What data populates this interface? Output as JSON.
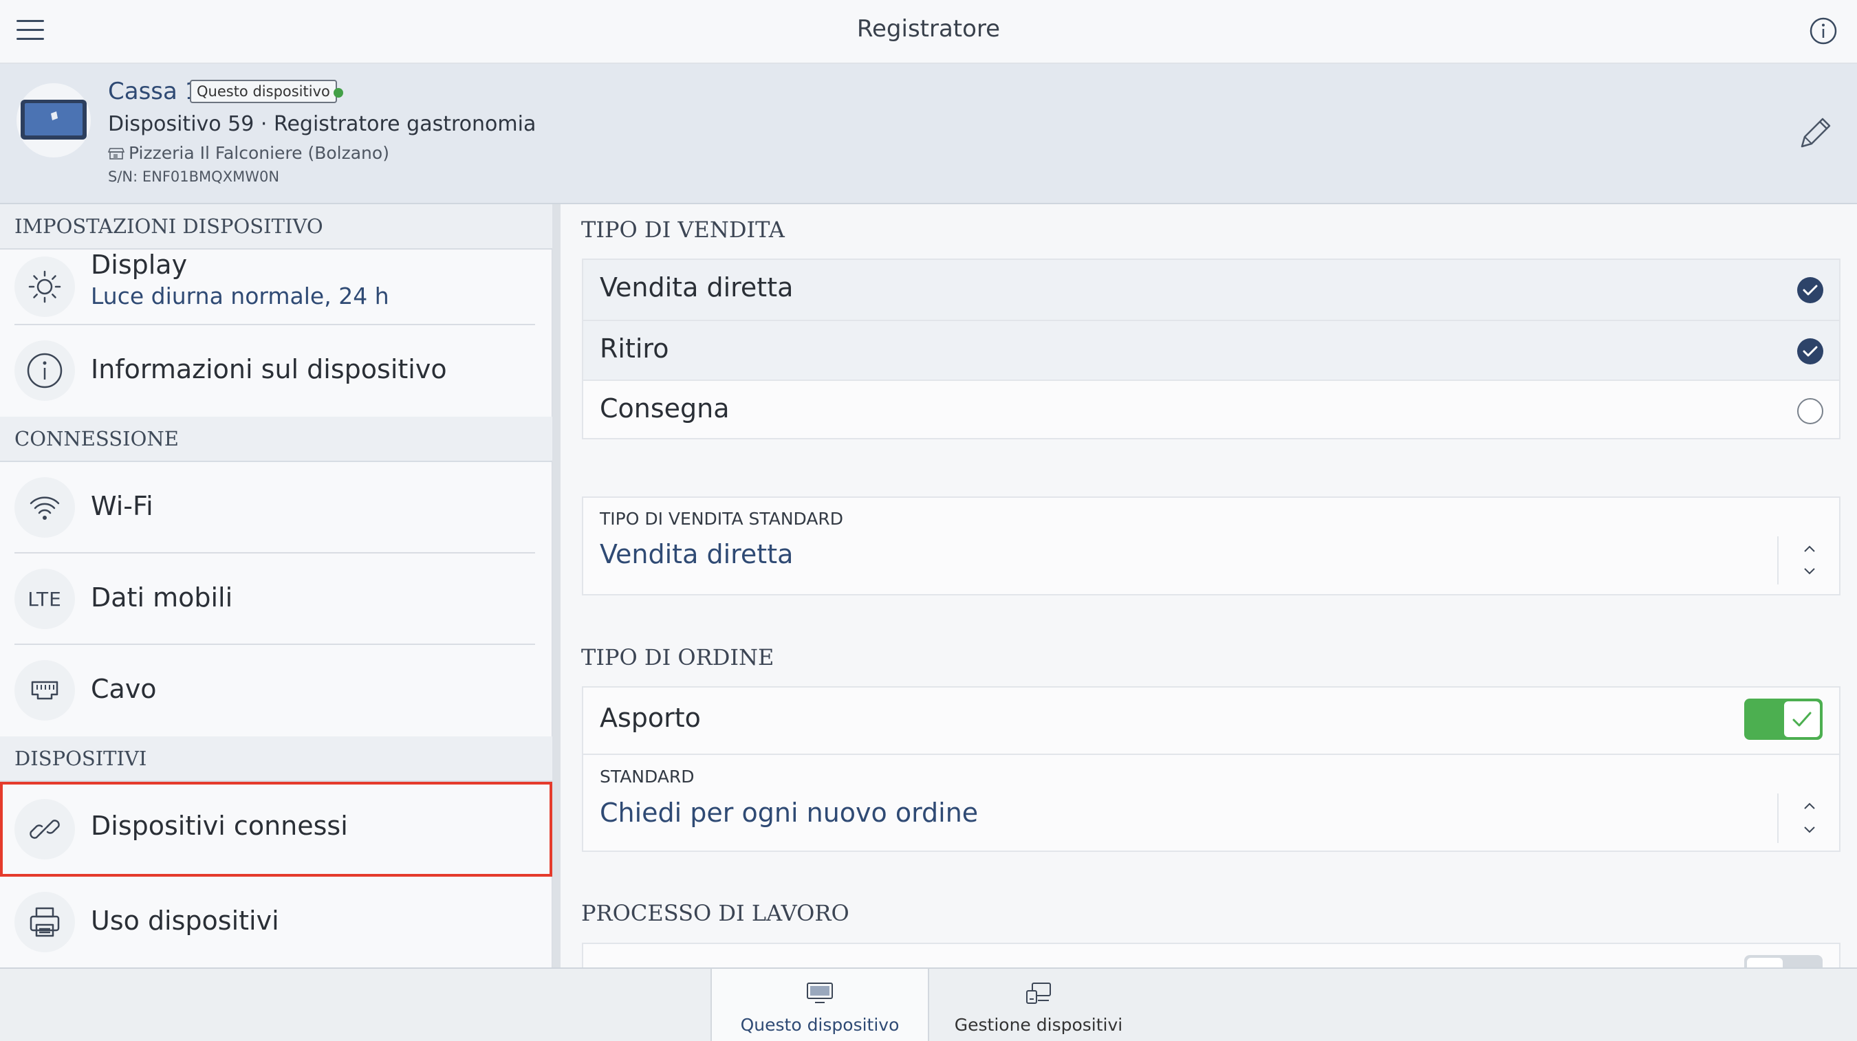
{
  "topbar": {
    "title": "Registratore"
  },
  "device": {
    "name": "Cassa 1",
    "badge": "Questo dispositivo",
    "status_color": "#43a047",
    "description": "Dispositivo 59 · Registratore gastronomia",
    "location": "Pizzeria Il Falconiere (Bolzano)",
    "serial": "S/N: ENF01BMQXMW0N"
  },
  "left": {
    "section_device": "IMPOSTAZIONI DISPOSITIVO",
    "display": {
      "label": "Display",
      "sub": "Luce diurna normale, 24 h"
    },
    "device_info": {
      "label": "Informazioni sul dispositivo"
    },
    "section_connection": "CONNESSIONE",
    "wifi": {
      "label": "Wi-Fi"
    },
    "mobile": {
      "label": "Dati mobili",
      "icon_text": "LTE"
    },
    "cable": {
      "label": "Cavo"
    },
    "section_devices": "DISPOSITIVI",
    "connected": {
      "label": "Dispositivi connessi"
    },
    "usage": {
      "label": "Uso dispositivi"
    }
  },
  "right": {
    "sale_type_title": "TIPO DI VENDITA",
    "sale_types": [
      {
        "label": "Vendita diretta",
        "checked": true
      },
      {
        "label": "Ritiro",
        "checked": true
      },
      {
        "label": "Consegna",
        "checked": false
      }
    ],
    "standard_sale_type": {
      "label": "TIPO DI VENDITA STANDARD",
      "value": "Vendita diretta"
    },
    "order_type_title": "TIPO DI ORDINE",
    "takeaway": {
      "label": "Asporto",
      "on": true
    },
    "standard": {
      "label": "STANDARD",
      "value": "Chiedi per ogni nuovo ordine"
    },
    "workflow_title": "PROCESSO DI LAVORO"
  },
  "tabs": [
    {
      "label": "Questo dispositivo",
      "active": true
    },
    {
      "label": "Gestione dispositivi",
      "active": false
    }
  ],
  "colors": {
    "accent": "#2f4a74",
    "toggle_on": "#4caf50",
    "highlight": "#e53b2c"
  }
}
